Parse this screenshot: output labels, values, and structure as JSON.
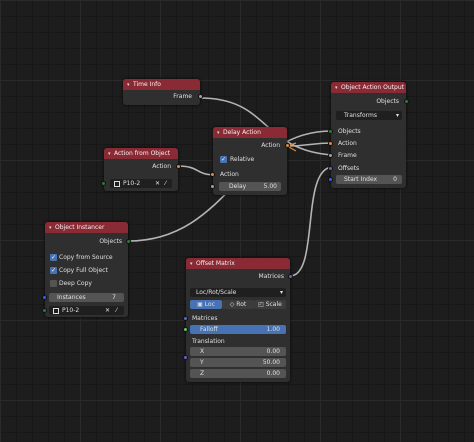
{
  "nodes": {
    "time_info": {
      "title": "Time Info",
      "frame": "Frame"
    },
    "action_from_object": {
      "title": "Action from Object",
      "action": "Action",
      "object_value": "P10-2"
    },
    "delay_action": {
      "title": "Delay Action",
      "action_out": "Action",
      "relative": "Relative",
      "action_in": "Action",
      "delay_label": "Delay",
      "delay_value": "5.00"
    },
    "object_action_output": {
      "title": "Object Action Output",
      "objects_out": "Objects",
      "mode": "Transforms",
      "objects_in": "Objects",
      "action": "Action",
      "frame": "Frame",
      "offsets": "Offsets",
      "start_index_label": "Start Index",
      "start_index_value": "0"
    },
    "object_instancer": {
      "title": "Object Instancer",
      "objects": "Objects",
      "copy_from_source": "Copy from Source",
      "copy_full_object": "Copy Full Object",
      "deep_copy": "Deep Copy",
      "instances_label": "Instances",
      "instances_value": "7",
      "object_value": "P10-2"
    },
    "offset_matrix": {
      "title": "Offset Matrix",
      "matrices_out": "Matrices",
      "mode": "Loc/Rot/Scale",
      "loc": "Loc",
      "rot": "Rot",
      "scale": "Scale",
      "matrices_in": "Matrices",
      "falloff": "Falloff",
      "falloff_value": "1.00",
      "translation": "Translation",
      "x_label": "X",
      "x_value": "0.00",
      "y_label": "Y",
      "y_value": "50.00",
      "z_label": "Z",
      "z_value": "0.00"
    }
  },
  "colors": {
    "canvas": "#1d1d1d",
    "node_body": "#2f2f2f",
    "header": "#8a2a34",
    "link": "#b4b4b4",
    "field_blue": "#4772b3"
  },
  "icons": {
    "checkmark": "✓",
    "chevron_down": "▾",
    "close": "✕",
    "eyedropper": "eyedropper-icon"
  }
}
